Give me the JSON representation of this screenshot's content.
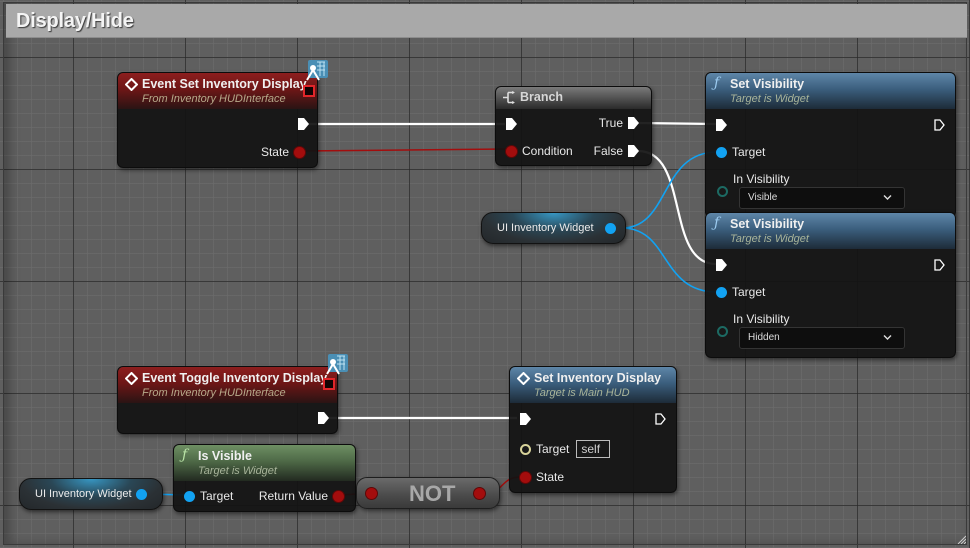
{
  "comment": {
    "title": "Display/Hide"
  },
  "colors": {
    "exec_wire": "#ffffff",
    "bool_wire": "#a30d0d",
    "object_wire": "#12a2f2",
    "event_header": "#8d1e1e",
    "function_header": "#3b5e7d",
    "pure_header": "#4e6947",
    "comment_header": "#a9a9a9"
  },
  "nodes": {
    "event_set_inventory_display": {
      "title": "Event Set Inventory Display",
      "subtitle": "From Inventory HUDInterface",
      "icon": "event-diamond-icon",
      "pins": {
        "state": "State"
      }
    },
    "branch": {
      "title": "Branch",
      "icon": "branch-icon",
      "pins": {
        "condition": "Condition",
        "true": "True",
        "false": "False"
      }
    },
    "set_visibility_1": {
      "title": "Set Visibility",
      "subtitle": "Target is Widget",
      "icon": "function-icon",
      "pins": {
        "target": "Target",
        "in_visibility": "In Visibility"
      },
      "in_visibility_value": "Visible"
    },
    "set_visibility_2": {
      "title": "Set Visibility",
      "subtitle": "Target is Widget",
      "icon": "function-icon",
      "pins": {
        "target": "Target",
        "in_visibility": "In Visibility"
      },
      "in_visibility_value": "Hidden"
    },
    "ui_inventory_widget_1": {
      "label": "UI Inventory Widget"
    },
    "event_toggle_inventory_display": {
      "title": "Event Toggle Inventory Display",
      "subtitle": "From Inventory HUDInterface",
      "icon": "event-diamond-icon"
    },
    "set_inventory_display": {
      "title": "Set Inventory Display",
      "subtitle": "Target is Main HUD",
      "icon": "event-diamond-icon",
      "pins": {
        "target": "Target",
        "state": "State"
      },
      "target_value": "self"
    },
    "is_visible": {
      "title": "Is Visible",
      "subtitle": "Target is Widget",
      "icon": "function-icon",
      "pins": {
        "target": "Target",
        "return_value": "Return Value"
      }
    },
    "ui_inventory_widget_2": {
      "label": "UI Inventory Widget"
    },
    "not": {
      "label": "NOT"
    }
  },
  "glyphs": {
    "function": "ƒ"
  }
}
